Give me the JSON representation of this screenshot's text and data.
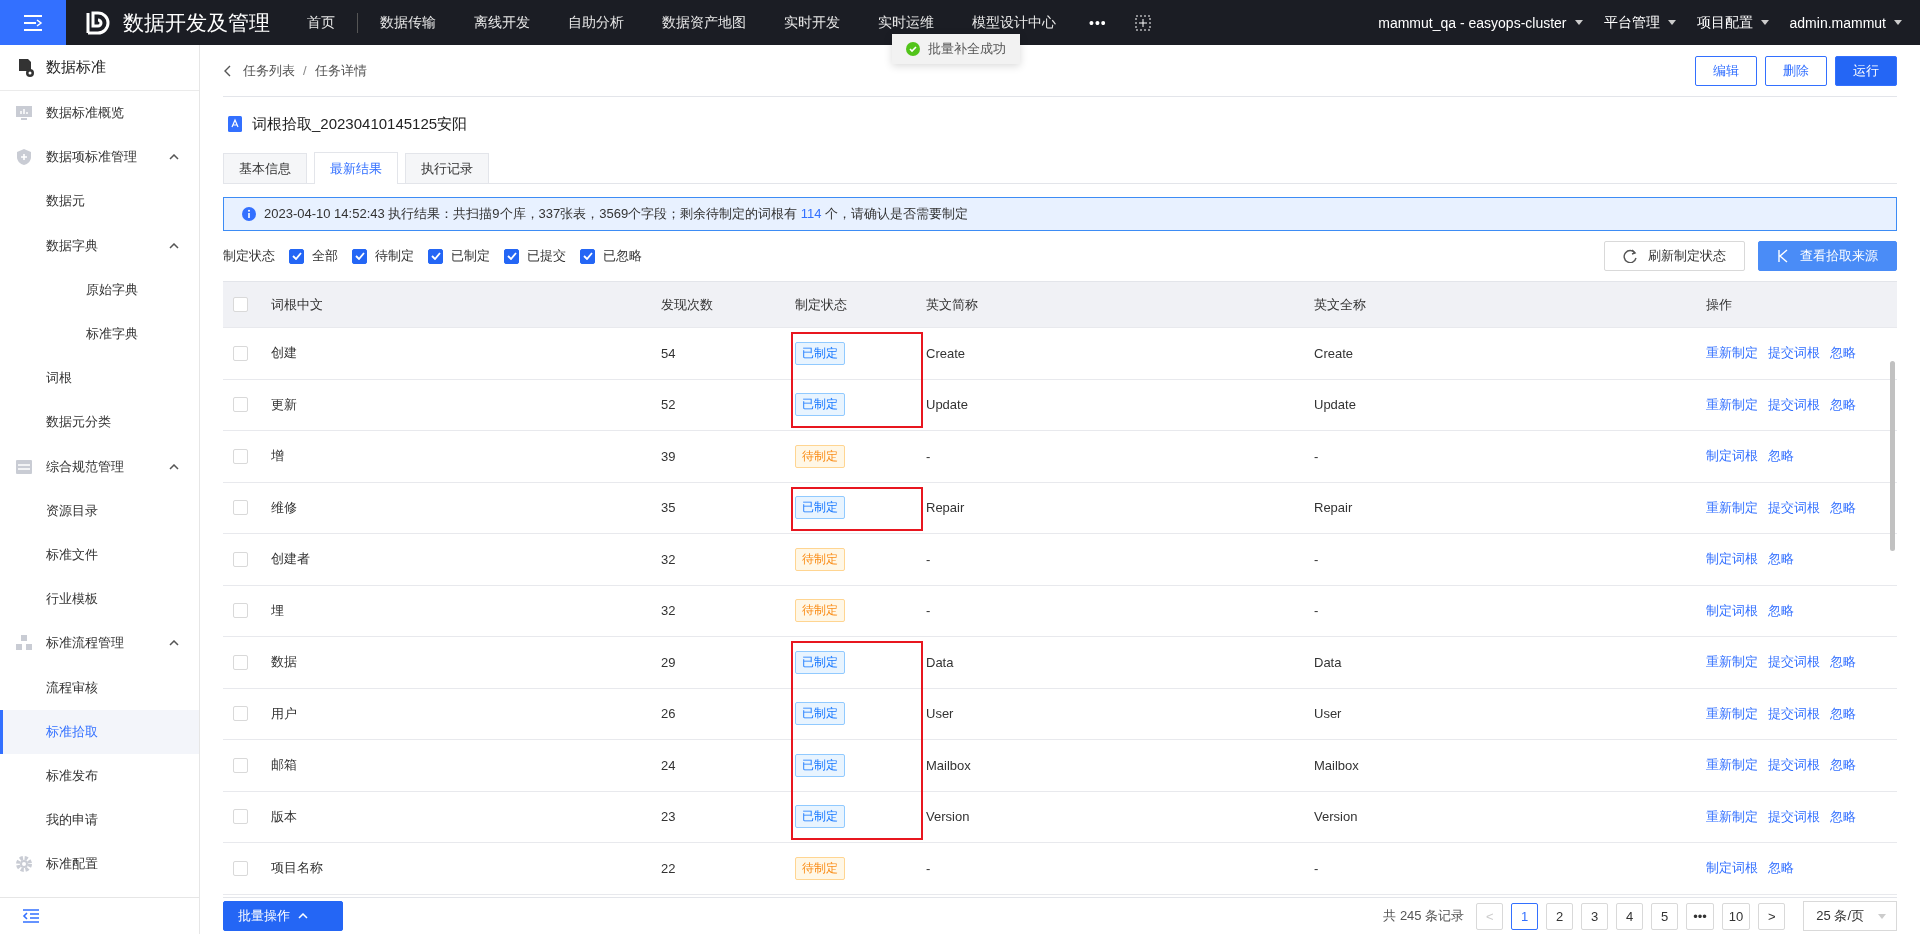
{
  "topbar": {
    "app_title": "数据开发及管理",
    "nav": [
      {
        "label": "首页",
        "selected": false
      },
      {
        "label": "数据传输",
        "selected": false
      },
      {
        "label": "离线开发",
        "selected": false
      },
      {
        "label": "自助分析",
        "selected": false
      },
      {
        "label": "数据资产地图",
        "selected": false
      },
      {
        "label": "实时开发",
        "selected": false
      },
      {
        "label": "实时运维",
        "selected": false
      },
      {
        "label": "模型设计中心",
        "selected": false
      }
    ],
    "more": "•••",
    "menus": [
      "mammut_qa - easyops-cluster",
      "平台管理",
      "项目配置",
      "admin.mammut"
    ]
  },
  "toast": {
    "text": "批量补全成功"
  },
  "sidebar": {
    "title": "数据标准",
    "items": [
      {
        "label": "数据标准概览",
        "selected": false
      },
      {
        "label": "数据项标准管理",
        "expanded": true,
        "selected": false,
        "children": [
          {
            "label": "数据元",
            "selected": false
          },
          {
            "label": "数据字典",
            "expanded": true,
            "selected": false,
            "children": [
              {
                "label": "原始字典",
                "selected": false
              },
              {
                "label": "标准字典",
                "selected": false
              }
            ]
          },
          {
            "label": "词根",
            "selected": false
          },
          {
            "label": "数据元分类",
            "selected": false
          }
        ]
      },
      {
        "label": "综合规范管理",
        "expanded": true,
        "selected": false,
        "children": [
          {
            "label": "资源目录",
            "selected": false
          },
          {
            "label": "标准文件",
            "selected": false
          },
          {
            "label": "行业模板",
            "selected": false
          }
        ]
      },
      {
        "label": "标准流程管理",
        "expanded": true,
        "selected": false,
        "children": [
          {
            "label": "流程审核",
            "selected": false
          },
          {
            "label": "标准拾取",
            "selected": true
          },
          {
            "label": "标准发布",
            "selected": false
          },
          {
            "label": "我的申请",
            "selected": false
          }
        ]
      },
      {
        "label": "标准配置",
        "selected": false
      }
    ]
  },
  "breadcrumb": {
    "items": [
      "任务列表",
      "任务详情"
    ],
    "separator": "/"
  },
  "actions": [
    {
      "label": "编辑",
      "kind": "outline"
    },
    {
      "label": "删除",
      "kind": "outline"
    },
    {
      "label": "运行",
      "kind": "primary"
    }
  ],
  "task_title": "词根拾取_20230410145125安阳",
  "tabs": [
    {
      "label": "基本信息",
      "selected": false
    },
    {
      "label": "最新结果",
      "selected": true
    },
    {
      "label": "执行记录",
      "selected": false
    }
  ],
  "info": "2023-04-10 14:52:43 执行结果：共扫描9个库，337张表，3569个字段；剩余待制定的词根有 **114** 个，请确认是否需要制定",
  "filter": {
    "label": "制定状态",
    "options": [
      {
        "label": "全部",
        "checked": true
      },
      {
        "label": "待制定",
        "checked": true
      },
      {
        "label": "已制定",
        "checked": true
      },
      {
        "label": "已提交",
        "checked": true
      },
      {
        "label": "已忽略",
        "checked": true
      }
    ]
  },
  "toolbar_buttons": [
    {
      "label": "刷新制定状态",
      "kind": "outline"
    },
    {
      "label": "查看拾取来源",
      "kind": "primary"
    }
  ],
  "table": {
    "select_all": false,
    "columns": [
      "词根中文",
      "发现次数",
      "制定状态",
      "英文简称",
      "英文全称",
      "操作"
    ],
    "rows": [
      {
        "checked": false,
        "name": "创建",
        "count": "54",
        "status": {
          "label": "已制定",
          "kind": "done"
        },
        "abbr": "Create",
        "full": "Create",
        "ops": [
          "重新制定",
          "提交词根",
          "忽略"
        ],
        "marked": true
      },
      {
        "checked": false,
        "name": "更新",
        "count": "52",
        "status": {
          "label": "已制定",
          "kind": "done"
        },
        "abbr": "Update",
        "full": "Update",
        "ops": [
          "重新制定",
          "提交词根",
          "忽略"
        ],
        "marked": true
      },
      {
        "checked": false,
        "name": "增",
        "count": "39",
        "status": {
          "label": "待制定",
          "kind": "pending"
        },
        "abbr": "-",
        "full": "-",
        "ops": [
          "制定词根",
          "忽略"
        ],
        "marked": false
      },
      {
        "checked": false,
        "name": "维修",
        "count": "35",
        "status": {
          "label": "已制定",
          "kind": "done"
        },
        "abbr": "Repair",
        "full": "Repair",
        "ops": [
          "重新制定",
          "提交词根",
          "忽略"
        ],
        "marked": true
      },
      {
        "checked": false,
        "name": "创建者",
        "count": "32",
        "status": {
          "label": "待制定",
          "kind": "pending"
        },
        "abbr": "-",
        "full": "-",
        "ops": [
          "制定词根",
          "忽略"
        ],
        "marked": false
      },
      {
        "checked": false,
        "name": "埋",
        "count": "32",
        "status": {
          "label": "待制定",
          "kind": "pending"
        },
        "abbr": "-",
        "full": "-",
        "ops": [
          "制定词根",
          "忽略"
        ],
        "marked": false
      },
      {
        "checked": false,
        "name": "数据",
        "count": "29",
        "status": {
          "label": "已制定",
          "kind": "done"
        },
        "abbr": "Data",
        "full": "Data",
        "ops": [
          "重新制定",
          "提交词根",
          "忽略"
        ],
        "marked": true
      },
      {
        "checked": false,
        "name": "用户",
        "count": "26",
        "status": {
          "label": "已制定",
          "kind": "done"
        },
        "abbr": "User",
        "full": "User",
        "ops": [
          "重新制定",
          "提交词根",
          "忽略"
        ],
        "marked": true
      },
      {
        "checked": false,
        "name": "邮箱",
        "count": "24",
        "status": {
          "label": "已制定",
          "kind": "done"
        },
        "abbr": "Mailbox",
        "full": "Mailbox",
        "ops": [
          "重新制定",
          "提交词根",
          "忽略"
        ],
        "marked": true
      },
      {
        "checked": false,
        "name": "版本",
        "count": "23",
        "status": {
          "label": "已制定",
          "kind": "done"
        },
        "abbr": "Version",
        "full": "Version",
        "ops": [
          "重新制定",
          "提交词根",
          "忽略"
        ],
        "marked": true
      },
      {
        "checked": false,
        "name": "项目名称",
        "count": "22",
        "status": {
          "label": "待制定",
          "kind": "pending"
        },
        "abbr": "-",
        "full": "-",
        "ops": [
          "制定词根",
          "忽略"
        ],
        "marked": false
      }
    ]
  },
  "batch_button": "批量操作",
  "pagination": {
    "total": "共 245 条记录",
    "prev": "<",
    "pages": [
      {
        "label": "1",
        "selected": true
      },
      {
        "label": "2",
        "selected": false
      },
      {
        "label": "3",
        "selected": false
      },
      {
        "label": "4",
        "selected": false
      },
      {
        "label": "5",
        "selected": false
      },
      {
        "label": "•••",
        "selected": false
      },
      {
        "label": "10",
        "selected": false
      }
    ],
    "next": ">",
    "page_size": "25 条/页"
  }
}
